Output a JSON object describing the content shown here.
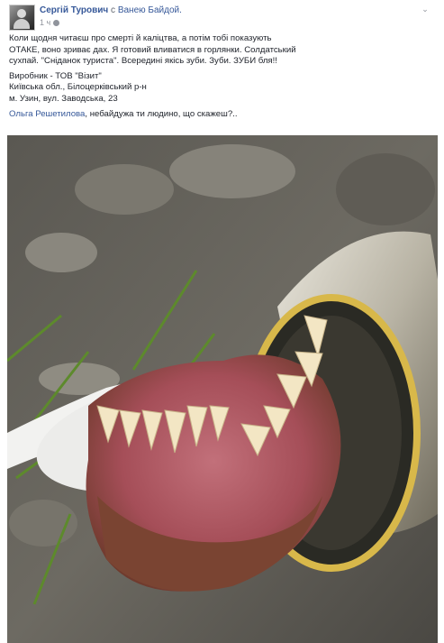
{
  "post": {
    "author": "Сергій Турович",
    "with_word": "с",
    "tagged": "Ванею Байдой.",
    "time": "1 ч",
    "text_lines": [
      "Коли щодня читаєш про смерті й каліцтва, а потім тобі показують",
      "ОТАКЕ, воно зриває дах. Я готовий вливатися в горлянки. Солдатський",
      "сухпай. \"Сніданок туриста\". Всередині якісь зуби. Зуби. ЗУБИ бля!!"
    ],
    "producer_lines": [
      "Виробник - ТОВ \"Візит\"",
      "Київська обл., Білоцерківський р-н",
      "м. Узин, вул. Заводська, 23"
    ],
    "mention_name": "Ольга Решетилова",
    "mention_rest": ", небайдужа ти людино, що скажеш?..",
    "icons": {
      "avatar": "profile-avatar",
      "privacy": "globe-icon",
      "menu": "chevron-down-icon"
    },
    "colors": {
      "link": "#365899",
      "meta": "#90949c",
      "text": "#1d2129"
    }
  }
}
